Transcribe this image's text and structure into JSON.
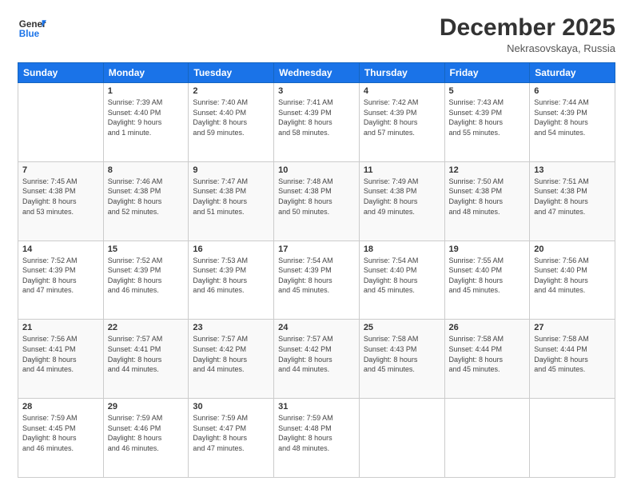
{
  "header": {
    "logo_line1": "General",
    "logo_line2": "Blue",
    "month": "December 2025",
    "location": "Nekrasovskaya, Russia"
  },
  "weekdays": [
    "Sunday",
    "Monday",
    "Tuesday",
    "Wednesday",
    "Thursday",
    "Friday",
    "Saturday"
  ],
  "rows": [
    [
      {
        "day": "",
        "info": ""
      },
      {
        "day": "1",
        "info": "Sunrise: 7:39 AM\nSunset: 4:40 PM\nDaylight: 9 hours\nand 1 minute."
      },
      {
        "day": "2",
        "info": "Sunrise: 7:40 AM\nSunset: 4:40 PM\nDaylight: 8 hours\nand 59 minutes."
      },
      {
        "day": "3",
        "info": "Sunrise: 7:41 AM\nSunset: 4:39 PM\nDaylight: 8 hours\nand 58 minutes."
      },
      {
        "day": "4",
        "info": "Sunrise: 7:42 AM\nSunset: 4:39 PM\nDaylight: 8 hours\nand 57 minutes."
      },
      {
        "day": "5",
        "info": "Sunrise: 7:43 AM\nSunset: 4:39 PM\nDaylight: 8 hours\nand 55 minutes."
      },
      {
        "day": "6",
        "info": "Sunrise: 7:44 AM\nSunset: 4:39 PM\nDaylight: 8 hours\nand 54 minutes."
      }
    ],
    [
      {
        "day": "7",
        "info": "Sunrise: 7:45 AM\nSunset: 4:38 PM\nDaylight: 8 hours\nand 53 minutes."
      },
      {
        "day": "8",
        "info": "Sunrise: 7:46 AM\nSunset: 4:38 PM\nDaylight: 8 hours\nand 52 minutes."
      },
      {
        "day": "9",
        "info": "Sunrise: 7:47 AM\nSunset: 4:38 PM\nDaylight: 8 hours\nand 51 minutes."
      },
      {
        "day": "10",
        "info": "Sunrise: 7:48 AM\nSunset: 4:38 PM\nDaylight: 8 hours\nand 50 minutes."
      },
      {
        "day": "11",
        "info": "Sunrise: 7:49 AM\nSunset: 4:38 PM\nDaylight: 8 hours\nand 49 minutes."
      },
      {
        "day": "12",
        "info": "Sunrise: 7:50 AM\nSunset: 4:38 PM\nDaylight: 8 hours\nand 48 minutes."
      },
      {
        "day": "13",
        "info": "Sunrise: 7:51 AM\nSunset: 4:38 PM\nDaylight: 8 hours\nand 47 minutes."
      }
    ],
    [
      {
        "day": "14",
        "info": "Sunrise: 7:52 AM\nSunset: 4:39 PM\nDaylight: 8 hours\nand 47 minutes."
      },
      {
        "day": "15",
        "info": "Sunrise: 7:52 AM\nSunset: 4:39 PM\nDaylight: 8 hours\nand 46 minutes."
      },
      {
        "day": "16",
        "info": "Sunrise: 7:53 AM\nSunset: 4:39 PM\nDaylight: 8 hours\nand 46 minutes."
      },
      {
        "day": "17",
        "info": "Sunrise: 7:54 AM\nSunset: 4:39 PM\nDaylight: 8 hours\nand 45 minutes."
      },
      {
        "day": "18",
        "info": "Sunrise: 7:54 AM\nSunset: 4:40 PM\nDaylight: 8 hours\nand 45 minutes."
      },
      {
        "day": "19",
        "info": "Sunrise: 7:55 AM\nSunset: 4:40 PM\nDaylight: 8 hours\nand 45 minutes."
      },
      {
        "day": "20",
        "info": "Sunrise: 7:56 AM\nSunset: 4:40 PM\nDaylight: 8 hours\nand 44 minutes."
      }
    ],
    [
      {
        "day": "21",
        "info": "Sunrise: 7:56 AM\nSunset: 4:41 PM\nDaylight: 8 hours\nand 44 minutes."
      },
      {
        "day": "22",
        "info": "Sunrise: 7:57 AM\nSunset: 4:41 PM\nDaylight: 8 hours\nand 44 minutes."
      },
      {
        "day": "23",
        "info": "Sunrise: 7:57 AM\nSunset: 4:42 PM\nDaylight: 8 hours\nand 44 minutes."
      },
      {
        "day": "24",
        "info": "Sunrise: 7:57 AM\nSunset: 4:42 PM\nDaylight: 8 hours\nand 44 minutes."
      },
      {
        "day": "25",
        "info": "Sunrise: 7:58 AM\nSunset: 4:43 PM\nDaylight: 8 hours\nand 45 minutes."
      },
      {
        "day": "26",
        "info": "Sunrise: 7:58 AM\nSunset: 4:44 PM\nDaylight: 8 hours\nand 45 minutes."
      },
      {
        "day": "27",
        "info": "Sunrise: 7:58 AM\nSunset: 4:44 PM\nDaylight: 8 hours\nand 45 minutes."
      }
    ],
    [
      {
        "day": "28",
        "info": "Sunrise: 7:59 AM\nSunset: 4:45 PM\nDaylight: 8 hours\nand 46 minutes."
      },
      {
        "day": "29",
        "info": "Sunrise: 7:59 AM\nSunset: 4:46 PM\nDaylight: 8 hours\nand 46 minutes."
      },
      {
        "day": "30",
        "info": "Sunrise: 7:59 AM\nSunset: 4:47 PM\nDaylight: 8 hours\nand 47 minutes."
      },
      {
        "day": "31",
        "info": "Sunrise: 7:59 AM\nSunset: 4:48 PM\nDaylight: 8 hours\nand 48 minutes."
      },
      {
        "day": "",
        "info": ""
      },
      {
        "day": "",
        "info": ""
      },
      {
        "day": "",
        "info": ""
      }
    ]
  ]
}
